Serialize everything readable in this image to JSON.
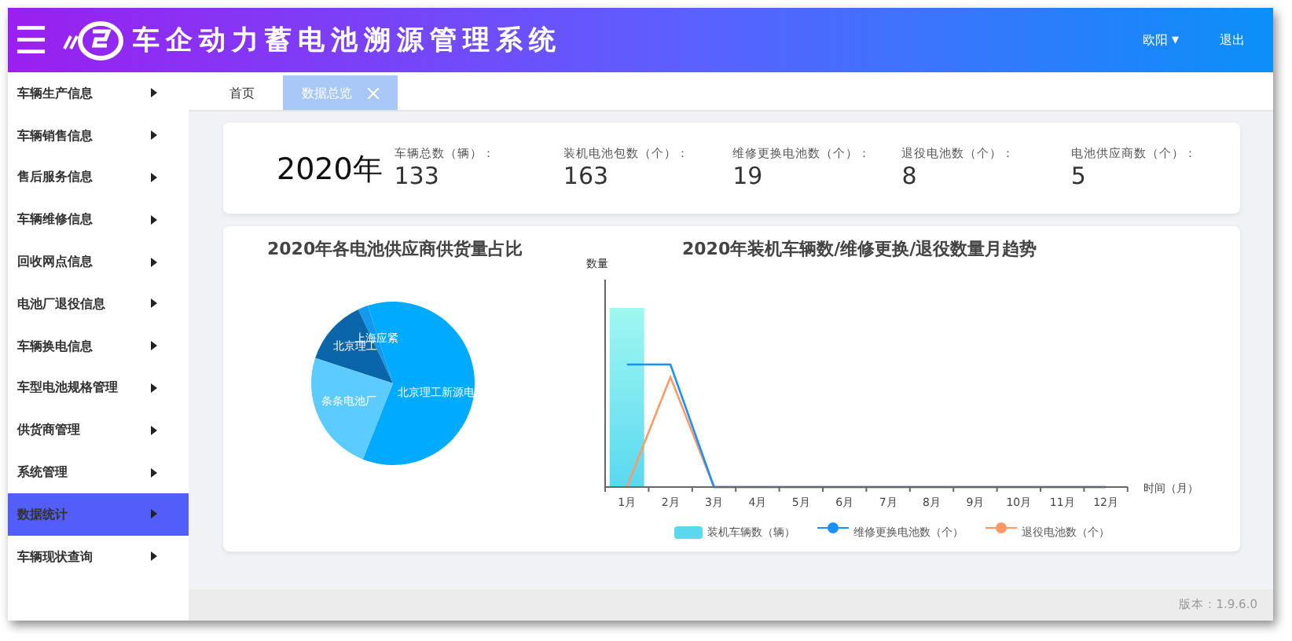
{
  "header": {
    "menu_icon": "☰",
    "title": "车企动力蓄电池溯源管理系统",
    "user": "欧阳",
    "user_caret": "▾",
    "logout": "退出"
  },
  "sidebar": {
    "items": [
      {
        "label": "车辆生产信息",
        "selected": false
      },
      {
        "label": "车辆销售信息",
        "selected": false
      },
      {
        "label": "售后服务信息",
        "selected": false
      },
      {
        "label": "车辆维修信息",
        "selected": false
      },
      {
        "label": "回收网点信息",
        "selected": false
      },
      {
        "label": "电池厂退役信息",
        "selected": false
      },
      {
        "label": "车辆换电信息",
        "selected": false
      },
      {
        "label": "车型电池规格管理",
        "selected": false
      },
      {
        "label": "供货商管理",
        "selected": false
      },
      {
        "label": "系统管理",
        "selected": false
      },
      {
        "label": "数据统计",
        "selected": true
      },
      {
        "label": "车辆现状查询",
        "selected": false
      }
    ]
  },
  "tabs": [
    {
      "label": "首页",
      "selected": false,
      "closable": false
    },
    {
      "label": "数据总览",
      "selected": true,
      "closable": true
    }
  ],
  "summary": {
    "year": "2020年",
    "stats": [
      {
        "label": "车辆总数（辆）：",
        "value": "133"
      },
      {
        "label": "装机电池包数（个）：",
        "value": "163"
      },
      {
        "label": "维修更换电池数（个）：",
        "value": "19"
      },
      {
        "label": "退役电池数（个）：",
        "value": "8"
      },
      {
        "label": "电池供应商数（个）：",
        "value": "5"
      }
    ]
  },
  "supplier_chart": {
    "title": "2020年各电池供应商供货量占比",
    "slices": [
      {
        "label": "上海应紧",
        "color": "#1499ee"
      },
      {
        "label": "北京理工",
        "color": "#0a66a8"
      },
      {
        "label": "北京理工新源电",
        "color": "#00aaff"
      },
      {
        "label": "条条电池厂",
        "color": "#5ccbff"
      }
    ]
  },
  "trend_chart": {
    "title": "2020年装机车辆数/维修更换/退役数量月趋势",
    "y_axis_name": "数量",
    "x_axis_name": "时间（月）",
    "months": [
      "1月",
      "2月",
      "3月",
      "4月",
      "5月",
      "6月",
      "7月",
      "8月",
      "9月",
      "10月",
      "11月",
      "12月"
    ],
    "legend": [
      {
        "kind": "bar",
        "label": "装机车辆数（辆）",
        "color": "#5ad8f0"
      },
      {
        "kind": "line",
        "label": "维修更换电池数（个）",
        "color": "#1890ff"
      },
      {
        "kind": "line",
        "label": "退役电池数（个）",
        "color": "#ff9966"
      }
    ]
  },
  "footer": {
    "version": "版本：1.9.6.0"
  }
}
